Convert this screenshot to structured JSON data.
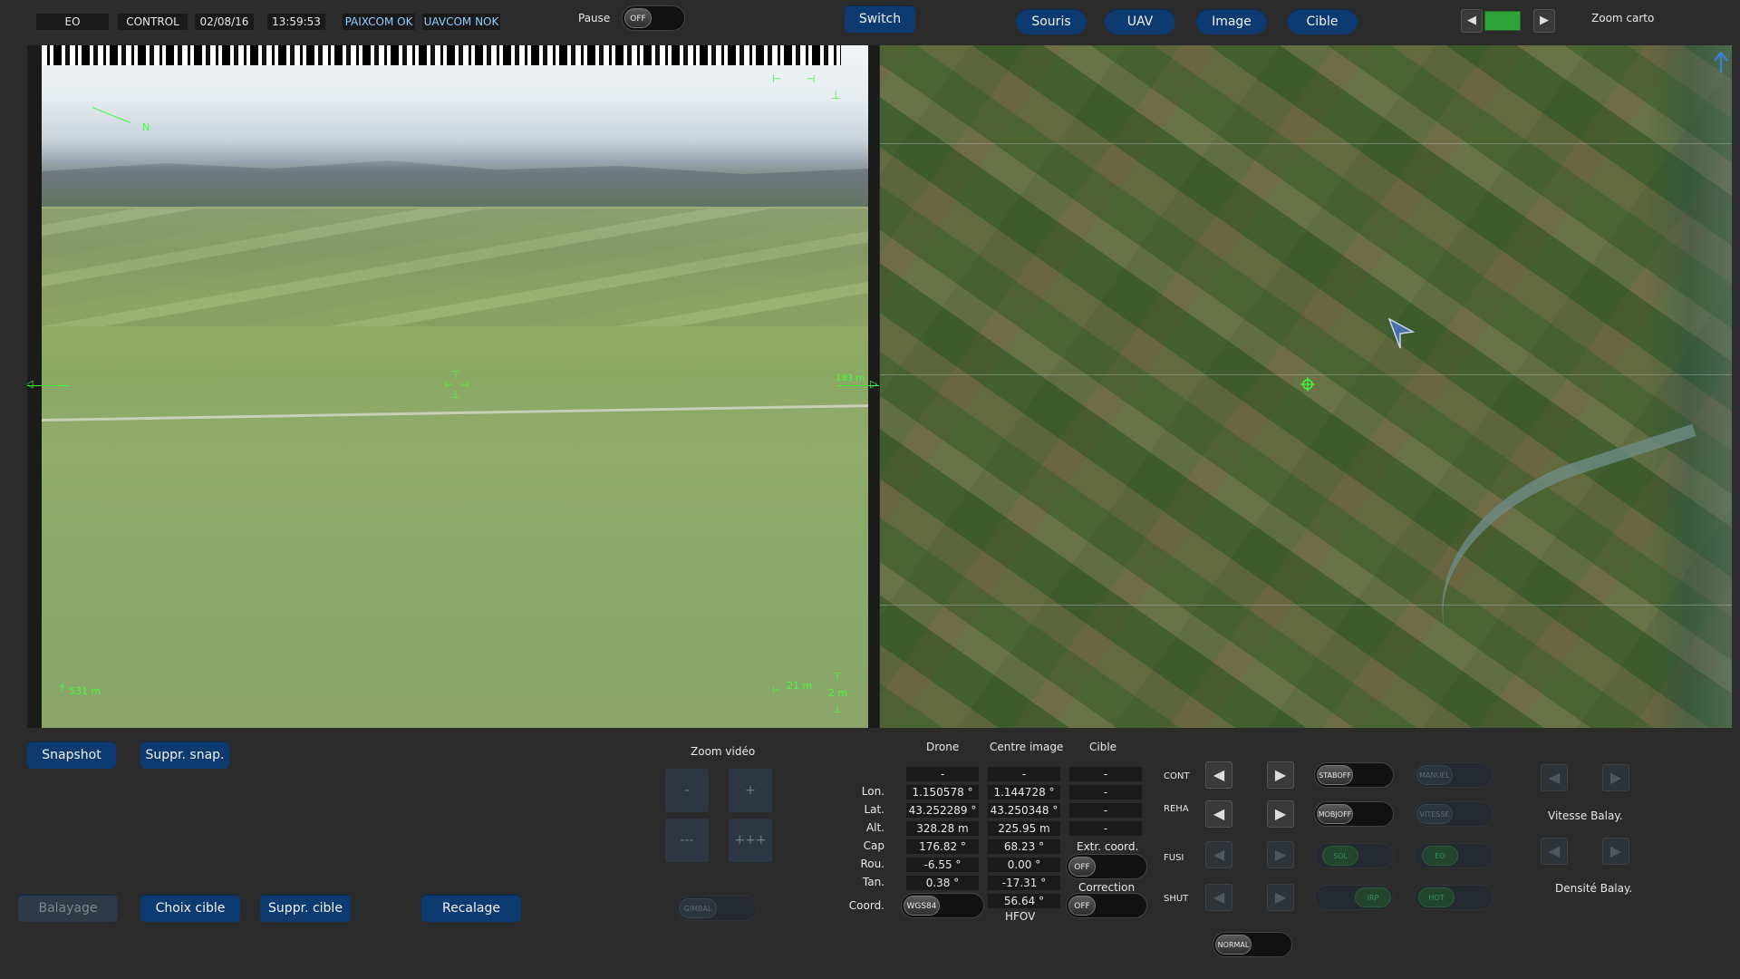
{
  "topbar": {
    "mode": "EO",
    "control": "CONTROL",
    "date": "02/08/16",
    "time": "13:59:53",
    "paixcom": "PAIXCOM OK",
    "uavcom": "UAVCOM NOK",
    "pause_label": "Pause",
    "pause_toggle": "OFF",
    "switch": "Switch",
    "tabs": [
      "Souris",
      "UAV",
      "Image",
      "Cible"
    ],
    "zoom_carto": "Zoom carto",
    "zoom_carto_left": "◀",
    "zoom_carto_right": "▶"
  },
  "video": {
    "north": "N",
    "alt_readout": "531 m",
    "dist_readout": "21 m",
    "scale_readout": "2 m",
    "right_marker": "183 m"
  },
  "bottom_left": {
    "snapshot": "Snapshot",
    "suppr_snap": "Suppr. snap.",
    "balayage": "Balayage",
    "choix_cible": "Choix cible",
    "suppr_cible": "Suppr. cible",
    "recalage": "Recalage",
    "zoom_video": "Zoom vidéo",
    "zoom_minus": "-",
    "zoom_plus": "+",
    "zoom_minus3": "---",
    "zoom_plus3": "+++",
    "gimbal": "GIMBAL"
  },
  "table": {
    "headers": [
      "Drone",
      "Centre image",
      "Cible"
    ],
    "rows": [
      {
        "label": "",
        "drone": "-",
        "centre": "-",
        "cible": "-"
      },
      {
        "label": "Lon.",
        "drone": "1.150578 °",
        "centre": "1.144728 °",
        "cible": "-"
      },
      {
        "label": "Lat.",
        "drone": "43.252289 °",
        "centre": "43.250348 °",
        "cible": "-"
      },
      {
        "label": "Alt.",
        "drone": "328.28 m",
        "centre": "225.95 m",
        "cible": "-"
      },
      {
        "label": "Cap",
        "drone": "176.82 °",
        "centre": "68.23 °",
        "cible": ""
      },
      {
        "label": "Rou.",
        "drone": "-6.55 °",
        "centre": "0.00 °",
        "cible": ""
      },
      {
        "label": "Tan.",
        "drone": "0.38 °",
        "centre": "-17.31 °",
        "cible": ""
      }
    ],
    "coord_label": "Coord.",
    "coord_toggle": "WGS84",
    "hfov_value": "56.64 °",
    "hfov_label": "HFOV",
    "extr_label": "Extr. coord.",
    "extr_toggle": "OFF",
    "correction_label": "Correction",
    "correction_toggle": "OFF"
  },
  "controls": {
    "rows": [
      {
        "label": "CONT",
        "t1": "STABOFF",
        "t2": "MANUEL"
      },
      {
        "label": "REHA",
        "t1": "MOBJOFF",
        "t2": "VITESSE"
      },
      {
        "label": "FUSI",
        "t1": "SOL",
        "t2": "EO"
      },
      {
        "label": "SHUT",
        "t1": "IRP",
        "t2": "HOT"
      }
    ],
    "normal": "NORMAL",
    "arrow_left": "◀",
    "arrow_right": "▶",
    "vitesse_balay": "Vitesse Balay.",
    "densite_balay": "Densité Balay."
  }
}
